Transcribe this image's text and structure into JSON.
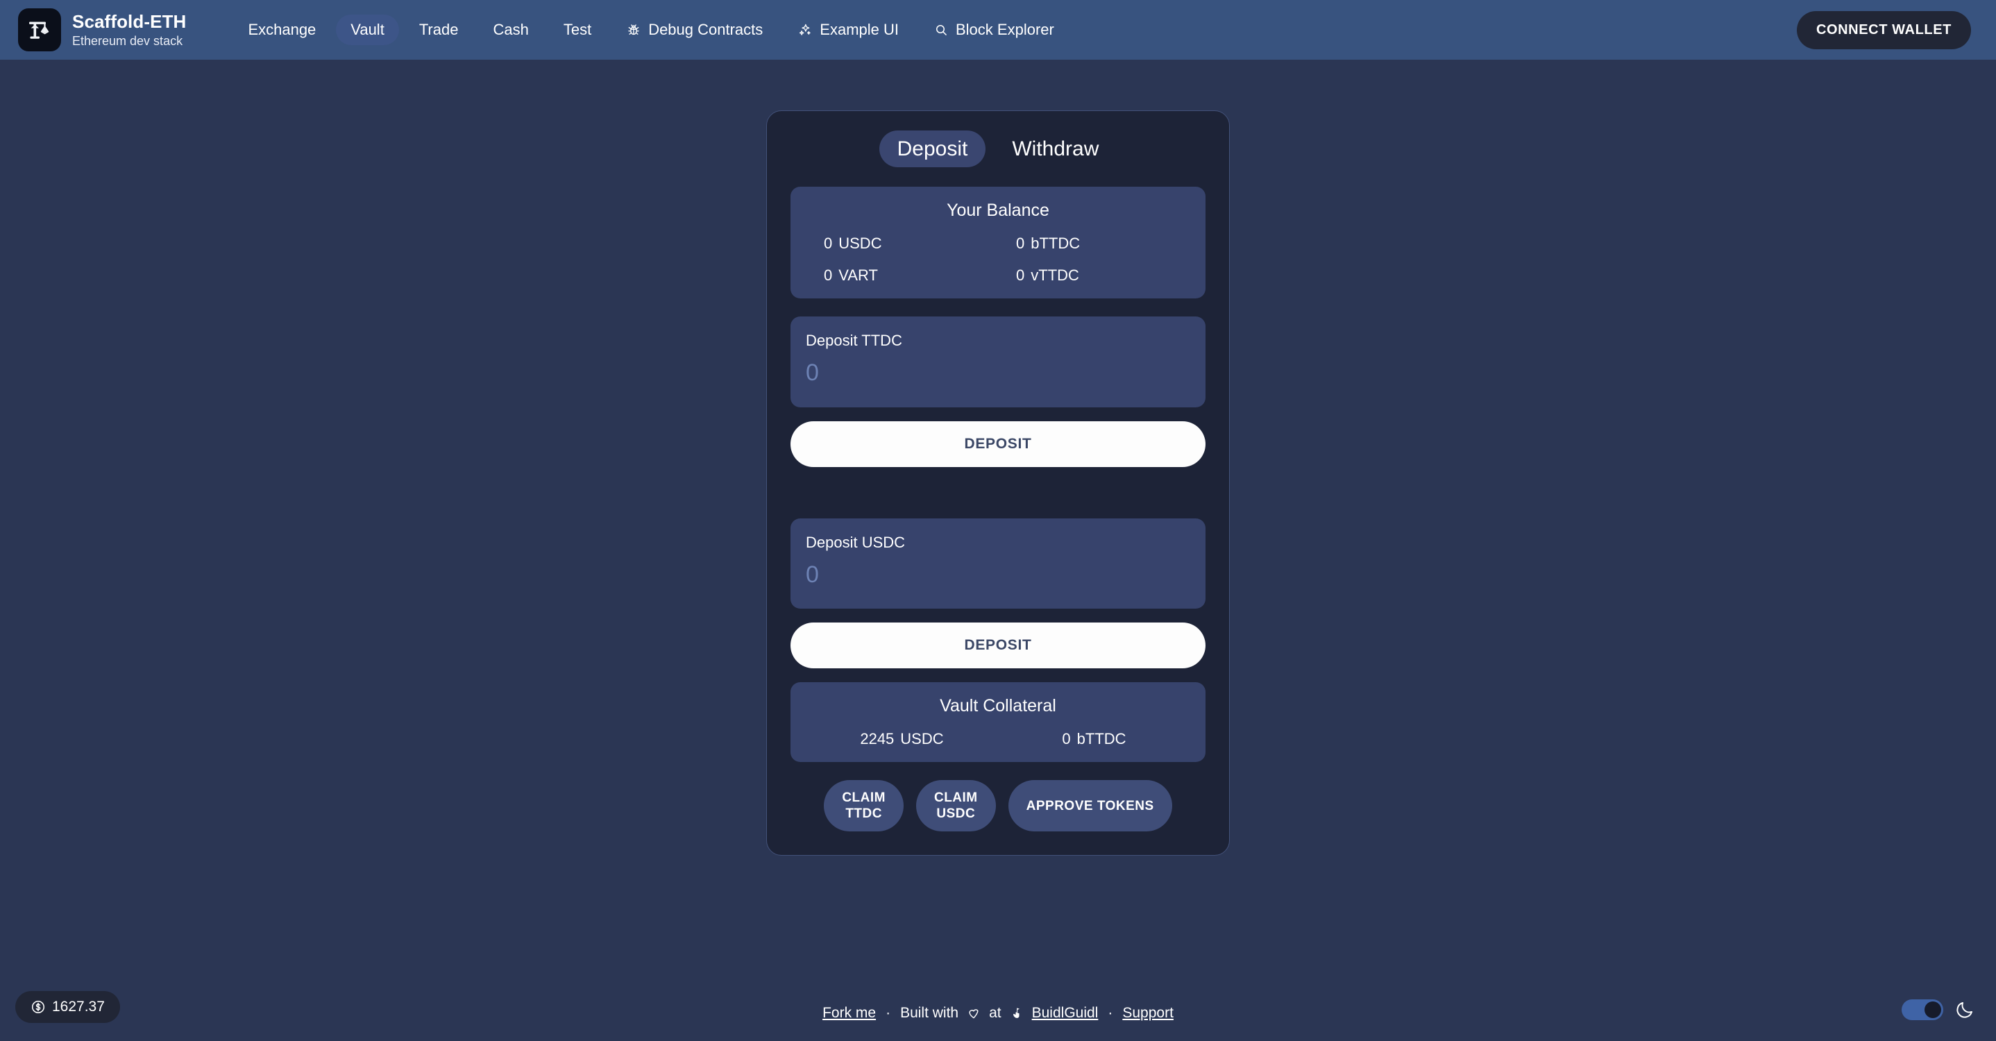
{
  "header": {
    "brand": {
      "title": "Scaffold-ETH",
      "subtitle": "Ethereum dev stack",
      "logo_icon": "scaffold-crane-eth-icon"
    },
    "nav_items": [
      {
        "label": "Exchange",
        "icon": null,
        "active": false
      },
      {
        "label": "Vault",
        "icon": null,
        "active": true
      },
      {
        "label": "Trade",
        "icon": null,
        "active": false
      },
      {
        "label": "Cash",
        "icon": null,
        "active": false
      },
      {
        "label": "Test",
        "icon": null,
        "active": false
      },
      {
        "label": "Debug Contracts",
        "icon": "bug-icon",
        "active": false
      },
      {
        "label": "Example UI",
        "icon": "sparkles-icon",
        "active": false
      },
      {
        "label": "Block Explorer",
        "icon": "search-icon",
        "active": false
      }
    ],
    "connect_wallet_label": "CONNECT WALLET"
  },
  "vault": {
    "tabs": [
      {
        "label": "Deposit",
        "active": true
      },
      {
        "label": "Withdraw",
        "active": false
      }
    ],
    "balance": {
      "title": "Your Balance",
      "rows": [
        {
          "amount": "0",
          "symbol": "USDC"
        },
        {
          "amount": "0",
          "symbol": "bTTDC"
        },
        {
          "amount": "0",
          "symbol": "VART"
        },
        {
          "amount": "0",
          "symbol": "vTTDC"
        }
      ]
    },
    "deposit_ttdc": {
      "label": "Deposit TTDC",
      "value": "",
      "placeholder": "0",
      "button_label": "DEPOSIT"
    },
    "deposit_usdc": {
      "label": "Deposit USDC",
      "value": "",
      "placeholder": "0",
      "button_label": "DEPOSIT"
    },
    "collateral": {
      "title": "Vault Collateral",
      "rows": [
        {
          "amount": "2245",
          "symbol": "USDC"
        },
        {
          "amount": "0",
          "symbol": "bTTDC"
        }
      ]
    },
    "actions": [
      {
        "label": "CLAIM\nTTDC",
        "name": "claim-ttdc-button"
      },
      {
        "label": "CLAIM\nUSDC",
        "name": "claim-usdc-button"
      },
      {
        "label": "APPROVE TOKENS",
        "name": "approve-tokens-button"
      }
    ]
  },
  "footer": {
    "price": {
      "value": "1627.37",
      "icon": "dollar-circle-icon"
    },
    "fork_me": "Fork me",
    "sep1": "·",
    "built_with": "Built with",
    "heart_icon": "heart-icon",
    "at": "at",
    "buidl_icon": "builder-hand-icon",
    "buidlguidl": "BuidlGuidl",
    "sep2": "·",
    "support": "Support",
    "theme_icon": "moon-icon"
  },
  "colors": {
    "navbar": "#38537f",
    "page_bg": "#2b3654",
    "card_bg": "#1d2337",
    "panel_bg": "#37436c",
    "accent_dark": "#212636",
    "primary_btn": "#fdfdfd",
    "action_btn": "#3f4d78"
  }
}
